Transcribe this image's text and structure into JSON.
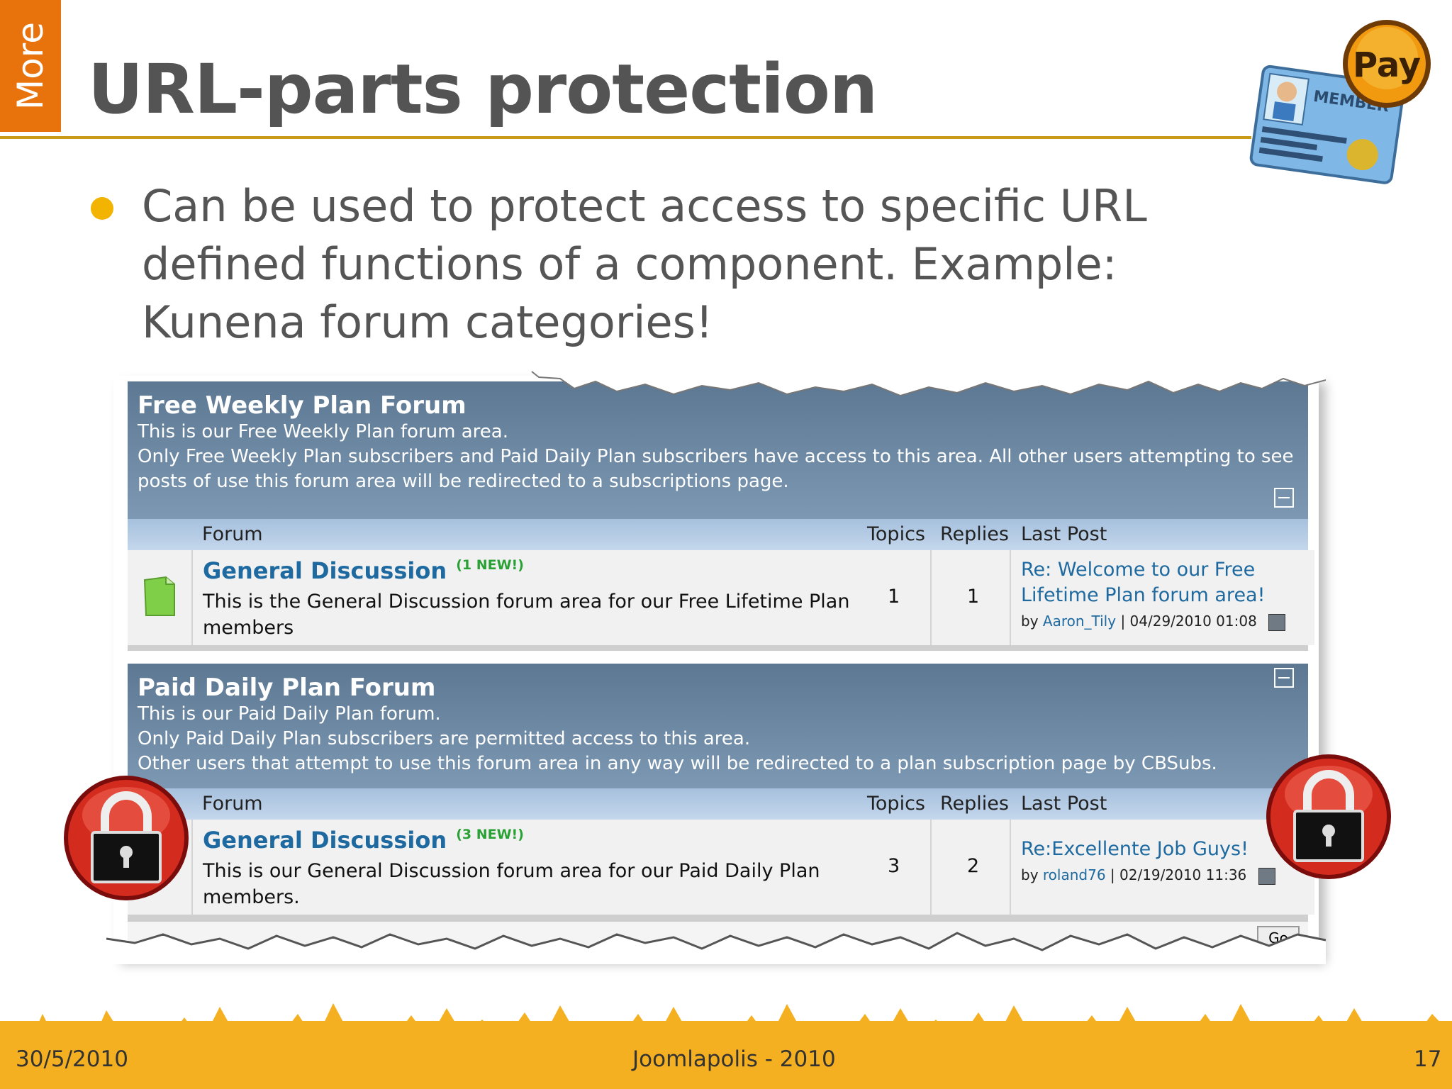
{
  "slide": {
    "side_tab": "More",
    "title": "URL-parts protection",
    "bullet": "Can be used to protect access to specific URL defined functions of a component. Example: Kunena forum categories!",
    "badge_pay": "Pay",
    "badge_member": "MEMBER"
  },
  "forum1": {
    "title": "Free Weekly Plan Forum",
    "desc1": "This is our Free Weekly Plan forum area.",
    "desc2": "Only Free Weekly Plan subscribers and Paid Daily Plan subscribers have access to this area. All other users attempting to see posts of use this forum area will be redirected to a subscriptions page.",
    "col_forum": "Forum",
    "col_topics": "Topics",
    "col_replies": "Replies",
    "col_last": "Last Post",
    "row_name": "General Discussion",
    "row_new": "(1 NEW!)",
    "row_desc": "This is the General Discussion forum area for our Free Lifetime Plan members",
    "topics": "1",
    "replies": "1",
    "last_title": "Re: Welcome to our Free Lifetime Plan forum area!",
    "last_by": "by",
    "last_user": "Aaron_Tily",
    "last_date": "| 04/29/2010 01:08"
  },
  "forum2": {
    "title": "Paid Daily Plan Forum",
    "desc1": "This is our Paid Daily Plan forum.",
    "desc2": "Only Paid Daily Plan subscribers are permitted access to this area.",
    "desc3": "Other users that attempt to use this forum area in any way will be redirected to a plan subscription page by CBSubs.",
    "col_forum": "Forum",
    "col_topics": "Topics",
    "col_replies": "Replies",
    "col_last": "Last Post",
    "row_name": "General Discussion",
    "row_new": "(3 NEW!)",
    "row_desc": "This is our General Discussion forum area for our Paid Daily Plan members.",
    "topics": "3",
    "replies": "2",
    "last_title": "Re:Excellente Job Guys!",
    "last_by": "by",
    "last_user": "roland76",
    "last_date": "| 02/19/2010 11:36"
  },
  "bottom_bar": {
    "go": "Go"
  },
  "footer": {
    "date": "30/5/2010",
    "center": "Joomlapolis - 2010",
    "page": "17"
  },
  "colors": {
    "accent": "#e8720c",
    "bullet": "#f2b400",
    "rule": "#c89a18",
    "forum_header": "#5d7892",
    "link": "#1e6aa0"
  },
  "icons": [
    "padlock-icon",
    "padlock-icon",
    "forum-folder-icon",
    "collapse-icon",
    "jump-icon",
    "member-card-icon"
  ]
}
